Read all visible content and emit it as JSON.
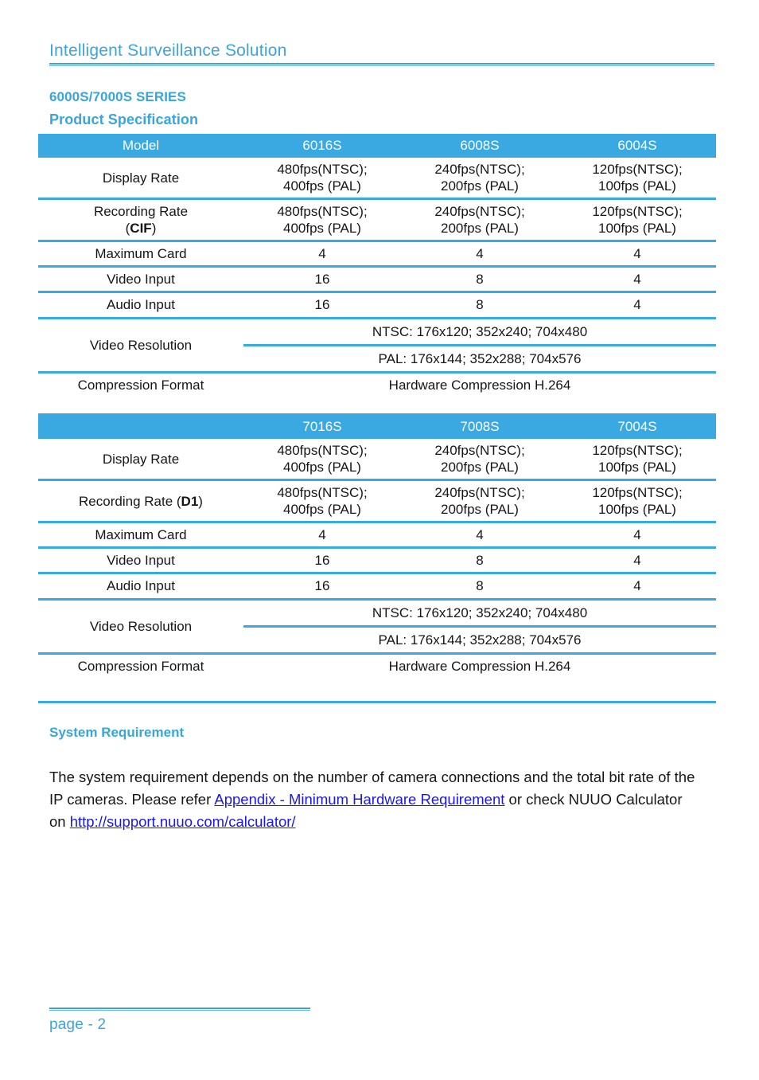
{
  "header": {
    "running_title": "Intelligent Surveillance Solution"
  },
  "headings": {
    "series": "6000S/7000S SERIES",
    "product_spec": "Product Specification",
    "system_requirement": "System Requirement"
  },
  "colors": {
    "accent": "#3aa9e2",
    "heading": "#39a5db",
    "link": "#1a16f0",
    "text": "#161616"
  },
  "tables": [
    {
      "id": "table-6000s",
      "columns": [
        "Model",
        "6016S",
        "6008S",
        "6004S"
      ],
      "rows": [
        {
          "type": "standard",
          "label_line1": "Display Rate",
          "label_line2": "",
          "values": [
            "480fps(NTSC);\n400fps (PAL)",
            "240fps(NTSC);\n200fps (PAL)",
            "120fps(NTSC);\n100fps (PAL)"
          ]
        },
        {
          "type": "standard",
          "label_line1": "Recording Rate",
          "label_line2_prefix": "(",
          "label_line2_bold": "CIF",
          "label_line2_suffix": ")",
          "values": [
            "480fps(NTSC);\n400fps (PAL)",
            "240fps(NTSC);\n200fps (PAL)",
            "120fps(NTSC);\n100fps (PAL)"
          ]
        },
        {
          "type": "standard",
          "label_line1": "Maximum Card",
          "label_line2": "",
          "values": [
            "4",
            "4",
            "4"
          ]
        },
        {
          "type": "standard",
          "label_line1": "Video Input",
          "label_line2": "",
          "values": [
            "16",
            "8",
            "4"
          ]
        },
        {
          "type": "standard",
          "label_line1": "Audio Input",
          "label_line2": "",
          "values": [
            "16",
            "8",
            "4"
          ]
        },
        {
          "type": "split",
          "label_line1": "Video Resolution",
          "lines": [
            "NTSC: 176x120; 352x240; 704x480",
            "PAL: 176x144; 352x288; 704x576"
          ]
        },
        {
          "type": "span",
          "label_line1": "Compression Format",
          "value": "Hardware Compression H.264"
        }
      ]
    },
    {
      "id": "table-7000s",
      "columns": [
        "",
        "7016S",
        "7008S",
        "7004S"
      ],
      "rows": [
        {
          "type": "standard",
          "label_line1": "Display Rate",
          "label_line2": "",
          "values": [
            "480fps(NTSC);\n400fps (PAL)",
            "240fps(NTSC);\n200fps (PAL)",
            "120fps(NTSC);\n100fps (PAL)"
          ]
        },
        {
          "type": "standard",
          "label_line1_prefix": "Recording Rate (",
          "label_line1_bold": "D1",
          "label_line1_suffix": ")",
          "values": [
            "480fps(NTSC);\n400fps (PAL)",
            "240fps(NTSC);\n200fps (PAL)",
            "120fps(NTSC);\n100fps (PAL)"
          ]
        },
        {
          "type": "standard",
          "label_line1": "Maximum Card",
          "label_line2": "",
          "values": [
            "4",
            "4",
            "4"
          ]
        },
        {
          "type": "standard",
          "label_line1": "Video Input",
          "label_line2": "",
          "values": [
            "16",
            "8",
            "4"
          ]
        },
        {
          "type": "standard",
          "label_line1": "Audio Input",
          "label_line2": "",
          "values": [
            "16",
            "8",
            "4"
          ]
        },
        {
          "type": "split",
          "label_line1": "Video Resolution",
          "lines": [
            "NTSC: 176x120; 352x240; 704x480",
            "PAL: 176x144; 352x288; 704x576"
          ]
        },
        {
          "type": "span",
          "label_line1": "Compression Format",
          "value": "Hardware Compression H.264"
        }
      ]
    }
  ],
  "system_requirement": {
    "text_part1": "The system requirement depends on the number of camera connections and the total bit rate of the IP cameras. Please refer ",
    "link1": "Appendix - Minimum Hardware Requirement",
    "text_part2": " or check NUUO Calculator on ",
    "link2": "http://support.nuuo.com/calculator/"
  },
  "footer": {
    "page_label": "page - 2"
  }
}
